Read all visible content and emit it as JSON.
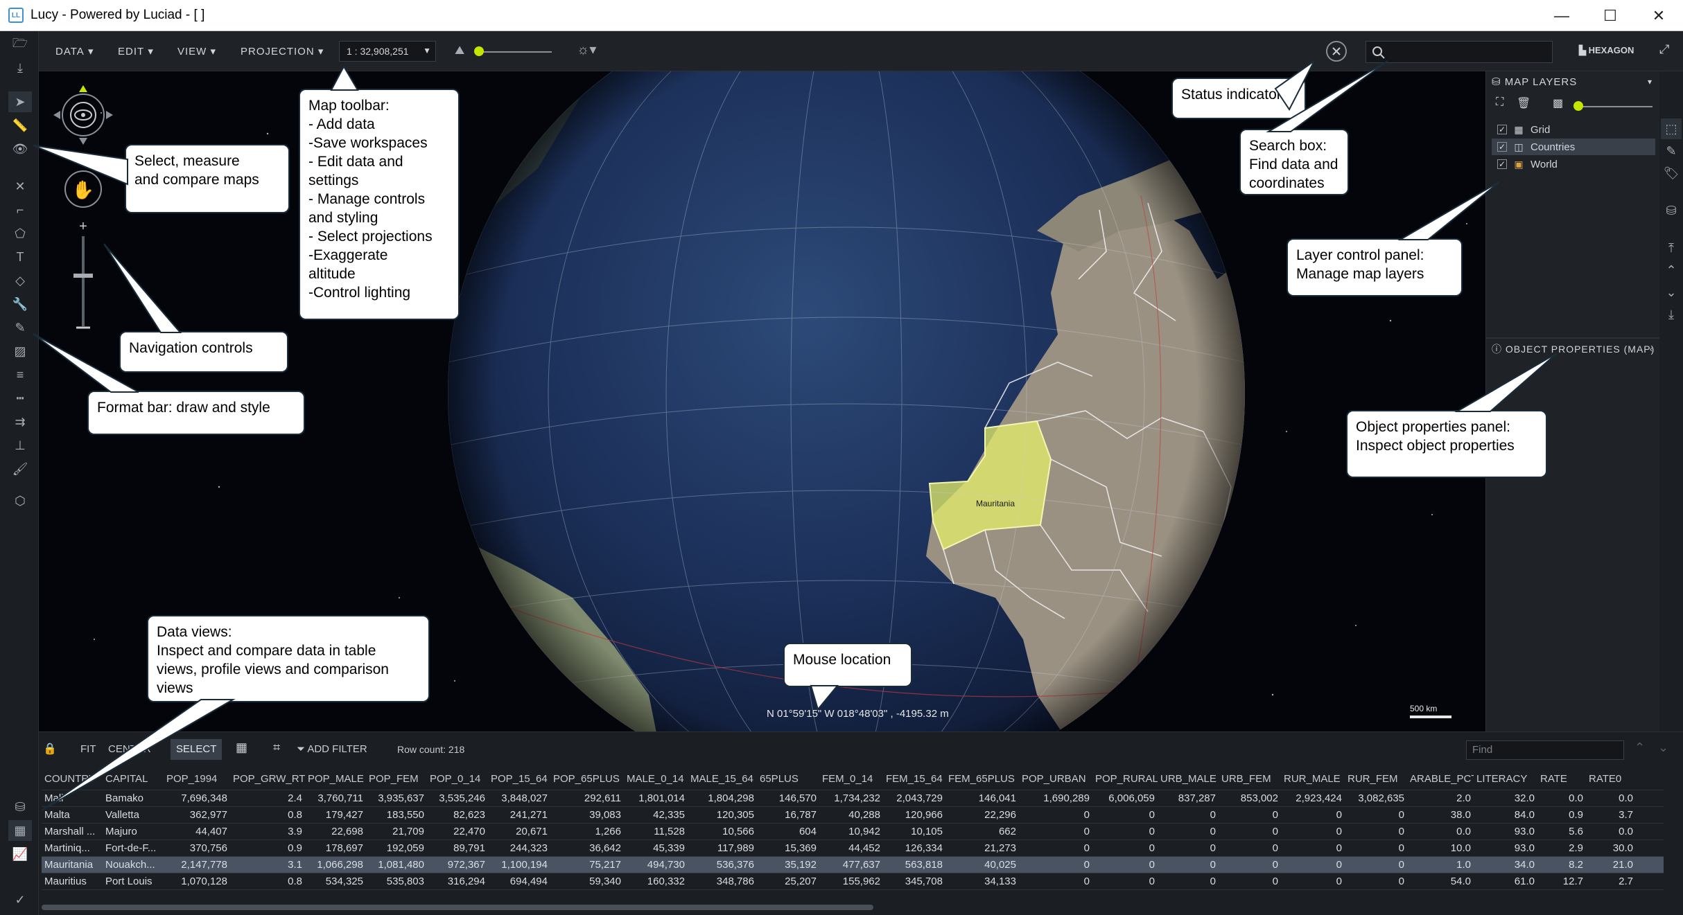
{
  "window": {
    "title": "Lucy - Powered by Luciad - [ ]",
    "logo_text": "LL"
  },
  "toolbar": {
    "menus": [
      "DATA",
      "EDIT",
      "VIEW",
      "PROJECTION"
    ],
    "scale": "1 : 32,908,251",
    "brand": "HEXAGON"
  },
  "map": {
    "selected_country_label": "Mauritania",
    "mouse_location": "N 01°59'15\" W 018°48'03\" , -4195.32 m",
    "scale_bar": "500 km"
  },
  "layers_panel": {
    "title": "MAP LAYERS",
    "layers": [
      {
        "name": "Grid",
        "checked": true,
        "selected": false,
        "icon": "grid-icon"
      },
      {
        "name": "Countries",
        "checked": true,
        "selected": true,
        "icon": "polygon-layer-icon"
      },
      {
        "name": "World",
        "checked": true,
        "selected": false,
        "icon": "raster-layer-icon"
      }
    ],
    "object_properties_title": "OBJECT PROPERTIES (MAP)"
  },
  "data_view": {
    "buttons": {
      "fit": "FIT",
      "center": "CENTER",
      "select": "SELECT",
      "add_filter": "ADD FILTER"
    },
    "row_count": "Row count: 218",
    "find_placeholder": "Find",
    "columns": [
      "COUNTRY",
      "CAPITAL",
      "POP_1994",
      "POP_GRW_RT",
      "POP_MALE",
      "POP_FEM",
      "POP_0_14",
      "POP_15_64",
      "POP_65PLUS",
      "MALE_0_14",
      "MALE_15_64",
      "65PLUS",
      "FEM_0_14",
      "FEM_15_64",
      "FEM_65PLUS",
      "POP_URBAN",
      "POP_RURAL",
      "URB_MALE",
      "URB_FEM",
      "RUR_MALE",
      "RUR_FEM",
      "ARABLE_PCT",
      "LITERACY",
      "RATE",
      "RATE0"
    ],
    "rows": [
      {
        "selected": false,
        "cells": [
          "Mali",
          "Bamako",
          "7,696,348",
          "2.4",
          "3,760,711",
          "3,935,637",
          "3,535,246",
          "3,848,027",
          "292,611",
          "1,801,014",
          "1,804,298",
          "146,570",
          "1,734,232",
          "2,043,729",
          "146,041",
          "1,690,289",
          "6,006,059",
          "837,287",
          "853,002",
          "2,923,424",
          "3,082,635",
          "2.0",
          "32.0",
          "0.0",
          "0.0"
        ]
      },
      {
        "selected": false,
        "cells": [
          "Malta",
          "Valletta",
          "362,977",
          "0.8",
          "179,427",
          "183,550",
          "82,623",
          "241,271",
          "39,083",
          "42,335",
          "120,305",
          "16,787",
          "40,288",
          "120,966",
          "22,296",
          "0",
          "0",
          "0",
          "0",
          "0",
          "0",
          "38.0",
          "84.0",
          "0.9",
          "3.7"
        ]
      },
      {
        "selected": false,
        "cells": [
          "Marshall ...",
          "Majuro",
          "44,407",
          "3.9",
          "22,698",
          "21,709",
          "22,470",
          "20,671",
          "1,266",
          "11,528",
          "10,566",
          "604",
          "10,942",
          "10,105",
          "662",
          "0",
          "0",
          "0",
          "0",
          "0",
          "0",
          "0.0",
          "93.0",
          "5.6",
          "0.0"
        ]
      },
      {
        "selected": false,
        "cells": [
          "Martiniq...",
          "Fort-de-F...",
          "370,756",
          "0.9",
          "178,697",
          "192,059",
          "89,791",
          "244,323",
          "36,642",
          "45,339",
          "117,989",
          "15,369",
          "44,452",
          "126,334",
          "21,273",
          "0",
          "0",
          "0",
          "0",
          "0",
          "0",
          "10.0",
          "93.0",
          "2.9",
          "30.0"
        ]
      },
      {
        "selected": true,
        "cells": [
          "Mauritania",
          "Nouakch...",
          "2,147,778",
          "3.1",
          "1,066,298",
          "1,081,480",
          "972,367",
          "1,100,194",
          "75,217",
          "494,730",
          "536,376",
          "35,192",
          "477,637",
          "563,818",
          "40,025",
          "0",
          "0",
          "0",
          "0",
          "0",
          "0",
          "1.0",
          "34.0",
          "8.2",
          "21.0"
        ]
      },
      {
        "selected": false,
        "cells": [
          "Mauritius",
          "Port Louis",
          "1,070,128",
          "0.8",
          "534,325",
          "535,803",
          "316,294",
          "694,494",
          "59,340",
          "160,332",
          "348,786",
          "25,207",
          "155,962",
          "345,708",
          "34,133",
          "0",
          "0",
          "0",
          "0",
          "0",
          "0",
          "54.0",
          "61.0",
          "12.7",
          "2.7"
        ]
      }
    ]
  },
  "callouts": {
    "map_toolbar": "Map toolbar:\n- Add data\n-Save workspaces\n- Edit data and\nsettings\n- Manage controls\nand styling\n- Select projections\n-Exaggerate\naltitude\n-Control lighting",
    "select_measure": "Select, measure\nand compare maps",
    "navigation": "Navigation controls",
    "format_bar": "Format bar: draw and style",
    "status_indicator": "Status indicator",
    "search_box": "Search box:\nFind data and\ncoordinates",
    "layer_control": "Layer control panel:\nManage map layers",
    "object_properties": "Object properties panel:\nInspect object properties",
    "data_views": "Data views:\nInspect and compare data in table\nviews, profile views and comparison\nviews",
    "mouse_location": "Mouse location"
  },
  "colors": {
    "accent": "#c5e600",
    "selection": "#e6ef6a",
    "panel": "#1f2328"
  }
}
